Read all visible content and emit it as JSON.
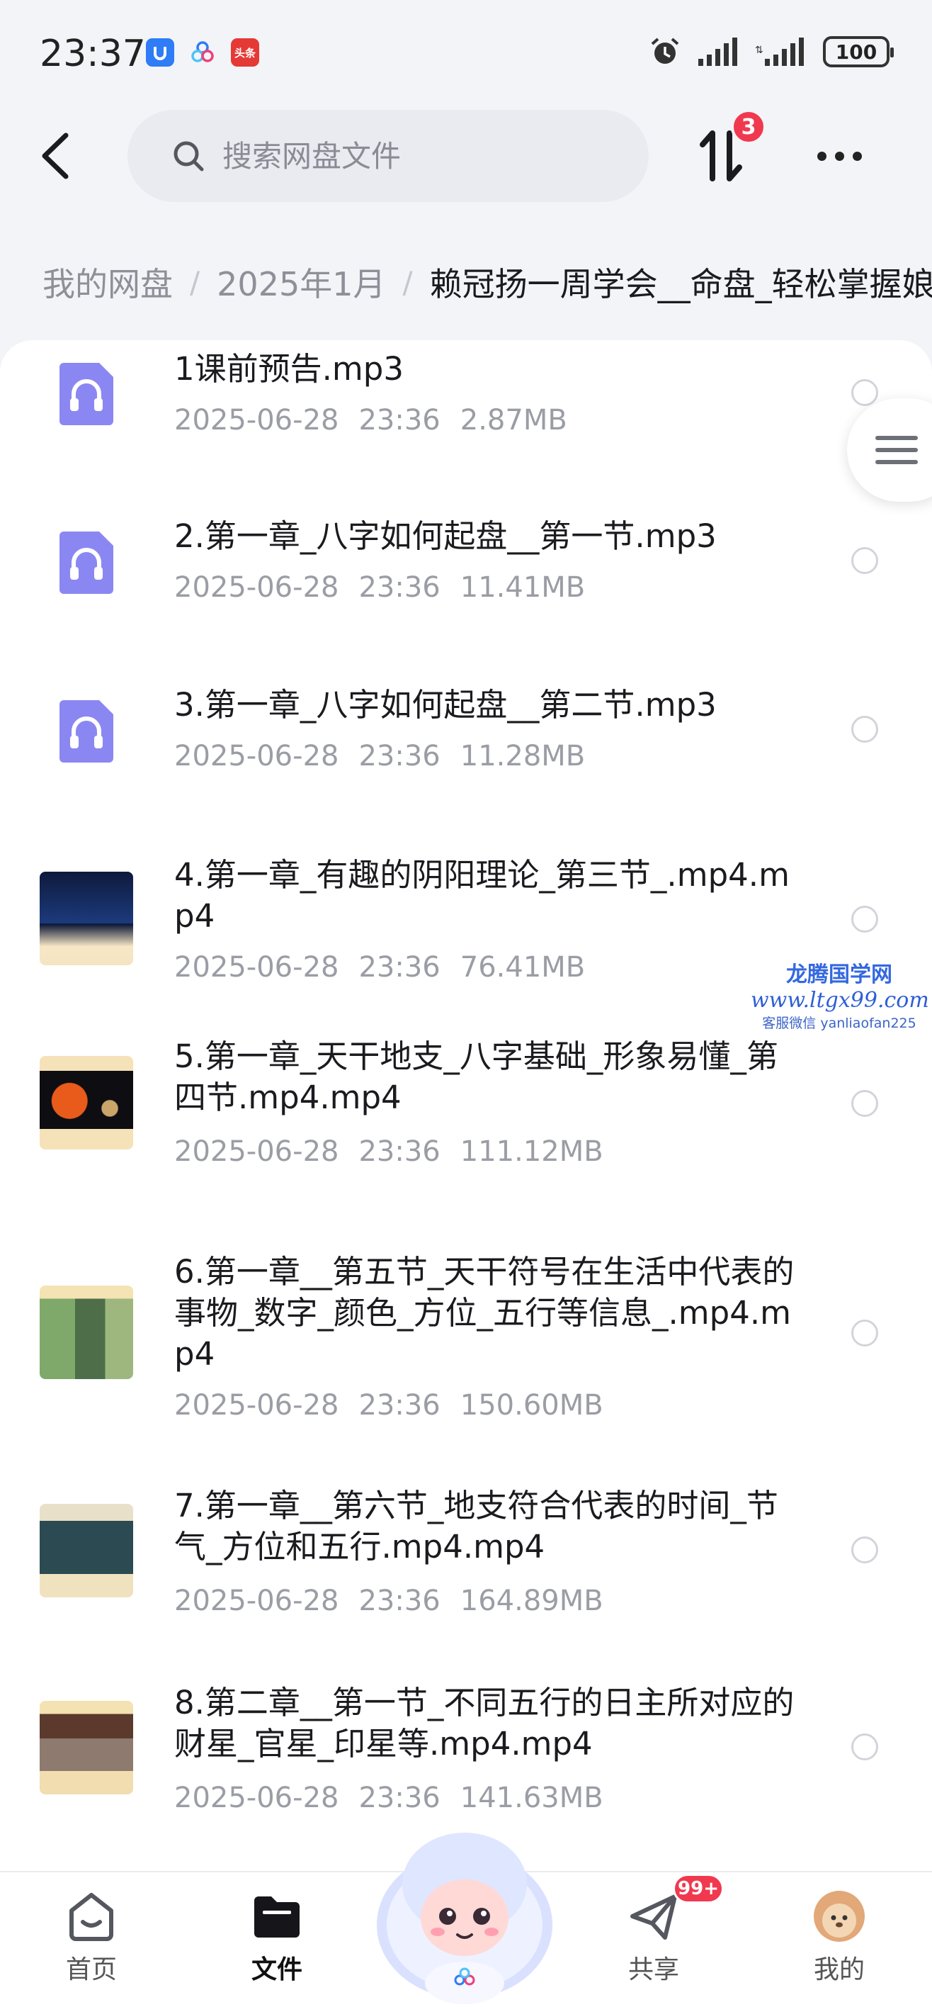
{
  "status_bar": {
    "time": "23:37",
    "battery": "100",
    "app_badge_red": "头条"
  },
  "header": {
    "search_placeholder": "搜索网盘文件",
    "transfer_badge": "3"
  },
  "breadcrumb": [
    {
      "label": "我的网盘"
    },
    {
      "label": "2025年1月"
    },
    {
      "label": "赖冠扬一周学会__命盘_轻松掌握娘"
    }
  ],
  "files": [
    {
      "type": "audio",
      "name": "1课前预告.mp3",
      "date": "2025-06-28",
      "time": "23:36",
      "size": "2.87MB"
    },
    {
      "type": "audio",
      "name": "2.第一章_八字如何起盘__第一节.mp3",
      "date": "2025-06-28",
      "time": "23:36",
      "size": "11.41MB"
    },
    {
      "type": "audio",
      "name": "3.第一章_八字如何起盘__第二节.mp3",
      "date": "2025-06-28",
      "time": "23:36",
      "size": "11.28MB"
    },
    {
      "type": "video",
      "thumb": "thumb-night",
      "name": "4.第一章_有趣的阴阳理论_第三节_.mp4.mp4",
      "date": "2025-06-28",
      "time": "23:36",
      "size": "76.41MB"
    },
    {
      "type": "video",
      "thumb": "thumb-planets",
      "name": "5.第一章_天干地支_八字基础_形象易懂_第四节.mp4.mp4",
      "date": "2025-06-28",
      "time": "23:36",
      "size": "111.12MB"
    },
    {
      "type": "video",
      "thumb": "thumb-leaves",
      "name": "6.第一章__第五节_天干符号在生活中代表的事物_数字_颜色_方位_五行等信息_.mp4.mp4",
      "date": "2025-06-28",
      "time": "23:36",
      "size": "150.60MB"
    },
    {
      "type": "video",
      "thumb": "thumb-mountain",
      "name": "7.第一章__第六节_地支符合代表的时间_节气_方位和五行.mp4.mp4",
      "date": "2025-06-28",
      "time": "23:36",
      "size": "164.89MB"
    },
    {
      "type": "video",
      "thumb": "thumb-people",
      "name": "8.第二章__第一节_不同五行的日主所对应的财星_官星_印星等.mp4.mp4",
      "date": "2025-06-28",
      "time": "23:36",
      "size": "141.63MB"
    }
  ],
  "watermark": {
    "title": "龙腾国学网",
    "site": "www.ltgx99.com",
    "contact": "客服微信 yanliaofan225"
  },
  "bottom_nav": {
    "home": "首页",
    "files": "文件",
    "share": "共享",
    "share_badge": "99+",
    "mine": "我的",
    "active": "files"
  },
  "colors": {
    "accent": "#8b87f2",
    "badge": "#f0394f",
    "background": "#f3f4f7"
  }
}
